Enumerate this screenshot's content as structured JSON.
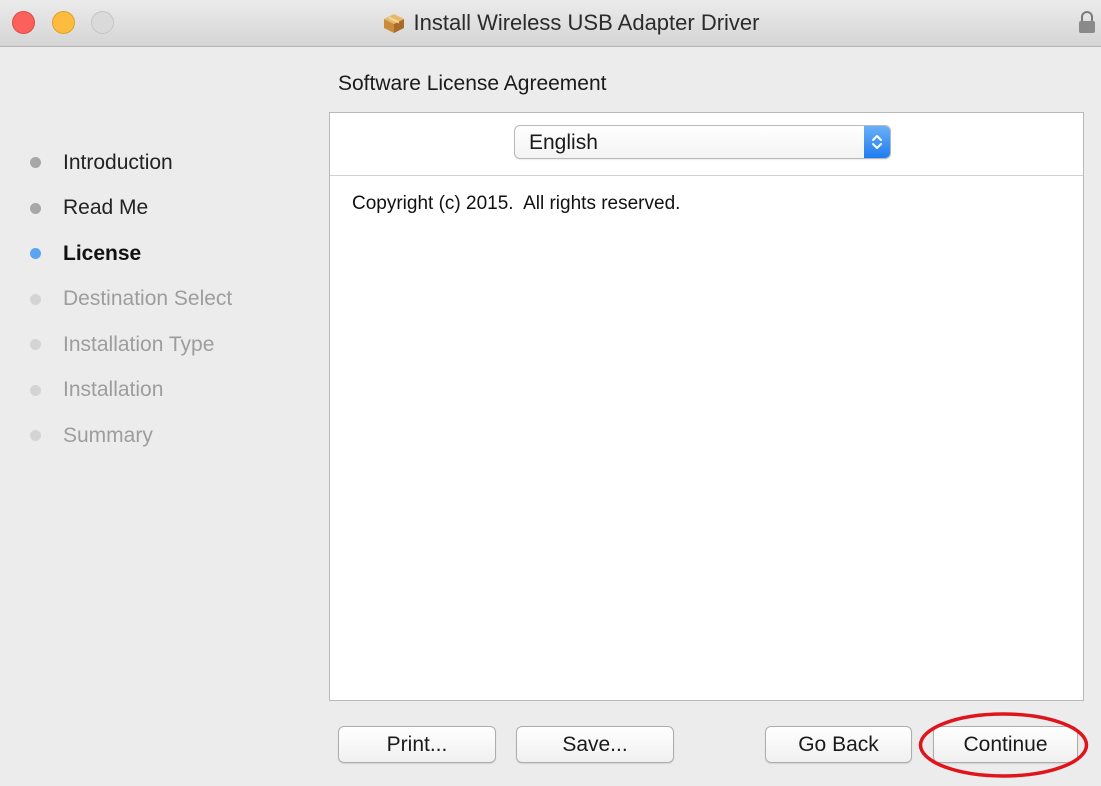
{
  "window": {
    "title": "Install Wireless USB Adapter Driver",
    "title_icon": "package-icon",
    "lock_icon": "lock-icon"
  },
  "sidebar": {
    "steps": [
      {
        "label": "Introduction",
        "state": "done"
      },
      {
        "label": "Read Me",
        "state": "done"
      },
      {
        "label": "License",
        "state": "current"
      },
      {
        "label": "Destination Select",
        "state": "future"
      },
      {
        "label": "Installation Type",
        "state": "future"
      },
      {
        "label": "Installation",
        "state": "future"
      },
      {
        "label": "Summary",
        "state": "future"
      }
    ]
  },
  "main": {
    "heading": "Software License Agreement",
    "language_select": {
      "value": "English"
    },
    "license_text": "Copyright (c) 2015.  All rights reserved."
  },
  "buttons": {
    "print": "Print...",
    "save": "Save...",
    "go_back": "Go Back",
    "continue": "Continue"
  },
  "colors": {
    "current_step_dot": "#5ba5f0",
    "highlight_ring": "#e0141b",
    "close_button": "#fc605c",
    "minimize_button": "#fdbc40"
  }
}
